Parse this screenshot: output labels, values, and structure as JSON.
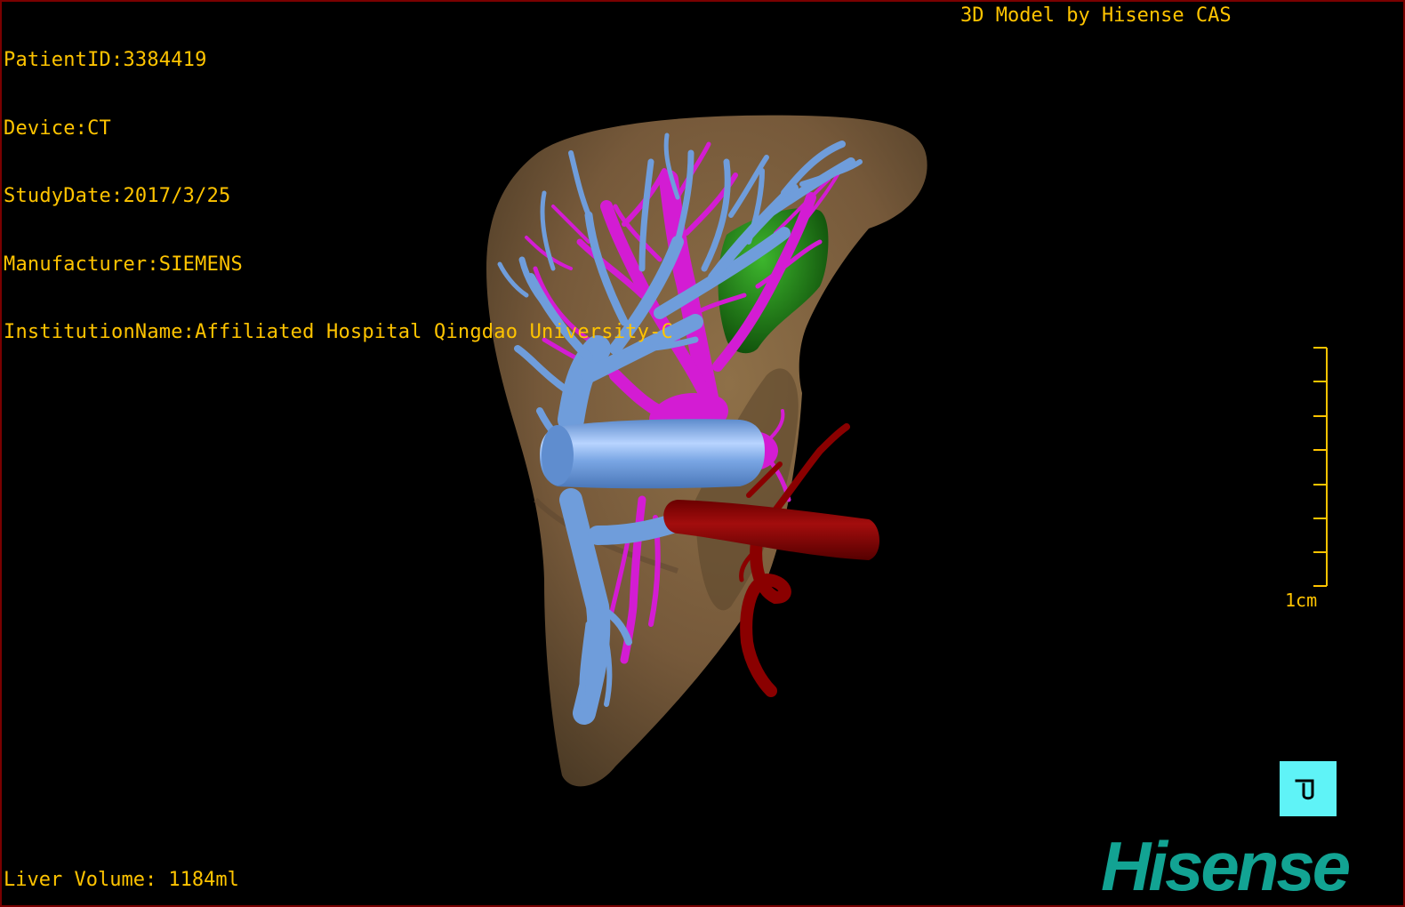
{
  "header": {
    "patient_id": "PatientID:3384419",
    "device": "Device:CT",
    "study_date": "StudyDate:2017/3/25",
    "manufacturer": "Manufacturer:SIEMENS",
    "institution": "InstitutionName:Affiliated Hospital Qingdao University-C"
  },
  "credit": "3D Model by Hisense CAS",
  "footer": {
    "liver_volume": "Liver Volume: 1184ml"
  },
  "scale_bar": {
    "label": "1cm"
  },
  "logo": {
    "text": "Hisense"
  },
  "colors": {
    "text": "#ffc400",
    "liver": "#7d6140",
    "portal_vein": "#6f9ddb",
    "hepatic_vein": "#d31cd3",
    "artery": "#8a0000",
    "gallbladder": "#1e7a14",
    "logo": "#12a393",
    "orient_button": "#5ff3f7"
  },
  "icons": {
    "orientation_reset": "orientation-reset-icon"
  }
}
